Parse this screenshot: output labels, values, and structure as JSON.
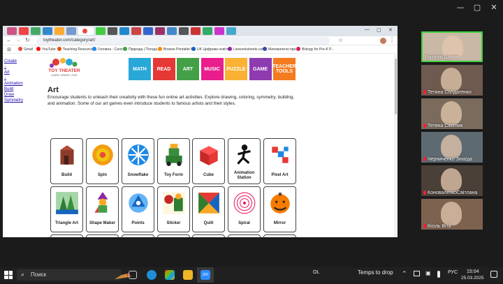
{
  "window": {
    "minimize": "—",
    "maximize": "▢",
    "close": "✕"
  },
  "browser": {
    "url": "toytheater.com/category/art/",
    "bookmarks": [
      {
        "label": "Gmail",
        "color": "#ea4335"
      },
      {
        "label": "YouTube",
        "color": "#ff0000"
      },
      {
        "label": "Teaching Resources...",
        "color": "#e65100"
      },
      {
        "label": "Головна - Сало",
        "color": "#1e88e5"
      },
      {
        "label": "Природа | Погода...",
        "color": "#43a047"
      },
      {
        "label": "Browse Printable W...",
        "color": "#fb8c00"
      },
      {
        "label": "UK Цифрова освіта...",
        "color": "#1565c0"
      },
      {
        "label": "Liveworksheets.com...",
        "color": "#8e24aa"
      },
      {
        "label": "Математичні при...",
        "color": "#3949ab"
      },
      {
        "label": "Biology for Pre-K P...",
        "color": "#d81b60"
      }
    ]
  },
  "sidebar_links": [
    "Create",
    "↓",
    "Art",
    "↓",
    "Animation",
    "Build",
    "Draw",
    "Symmetry"
  ],
  "logo": {
    "line1": "TOY THEATER",
    "line2": "LEARN • CREATE • PLAY"
  },
  "nav": [
    {
      "label": "MATH",
      "color": "#29a8d8"
    },
    {
      "label": "READ",
      "color": "#e53935"
    },
    {
      "label": "ART",
      "color": "#43a047"
    },
    {
      "label": "MUSIC",
      "color": "#e91e8c"
    },
    {
      "label": "PUZZLE",
      "color": "#f9b233"
    },
    {
      "label": "GAME",
      "color": "#8e3bb0"
    },
    {
      "label": "TEACHER TOOLS",
      "color": "#f47b20"
    }
  ],
  "page": {
    "title": "Art",
    "description": "Encourage students to unleash their creativity with these fun online art activities. Explore drawing, coloring, symmetry, building, and animation. Some of our art games even introduce students to famous artists and their styles."
  },
  "activities": [
    [
      "Build",
      "Spin",
      "Snowflake",
      "Toy Form",
      "Cube",
      "Animation Station",
      "Pixel Art"
    ],
    [
      "Triangle Art",
      "Shape Maker",
      "Points",
      "Sticker",
      "Quilt",
      "Spiral",
      "Mirror"
    ],
    [
      "",
      "",
      "",
      "",
      "",
      "",
      ""
    ]
  ],
  "participants": [
    {
      "name": "Вікторія Шуляк",
      "muted": false,
      "bg": "#c9b8a6"
    },
    {
      "name": "Тетяна Солдатенко",
      "muted": true,
      "bg": "#6e5a4e"
    },
    {
      "name": "Тетяна Сіменик",
      "muted": true,
      "bg": "#7a6b5d"
    },
    {
      "name": "Черниченко Зінаїда",
      "muted": true,
      "bg": "#5e6a72"
    },
    {
      "name": "КоноваленкоСвітлана",
      "muted": true,
      "bg": "#4a4038"
    },
    {
      "name": "Кісіль Віта",
      "muted": true,
      "bg": "#7e6250"
    }
  ],
  "taskbar": {
    "search_placeholder": "Поиск",
    "drop_text": "Temps to drop",
    "weather": "OL",
    "lang": "РУС",
    "time": "15:04",
    "date": "25.03.2025"
  }
}
